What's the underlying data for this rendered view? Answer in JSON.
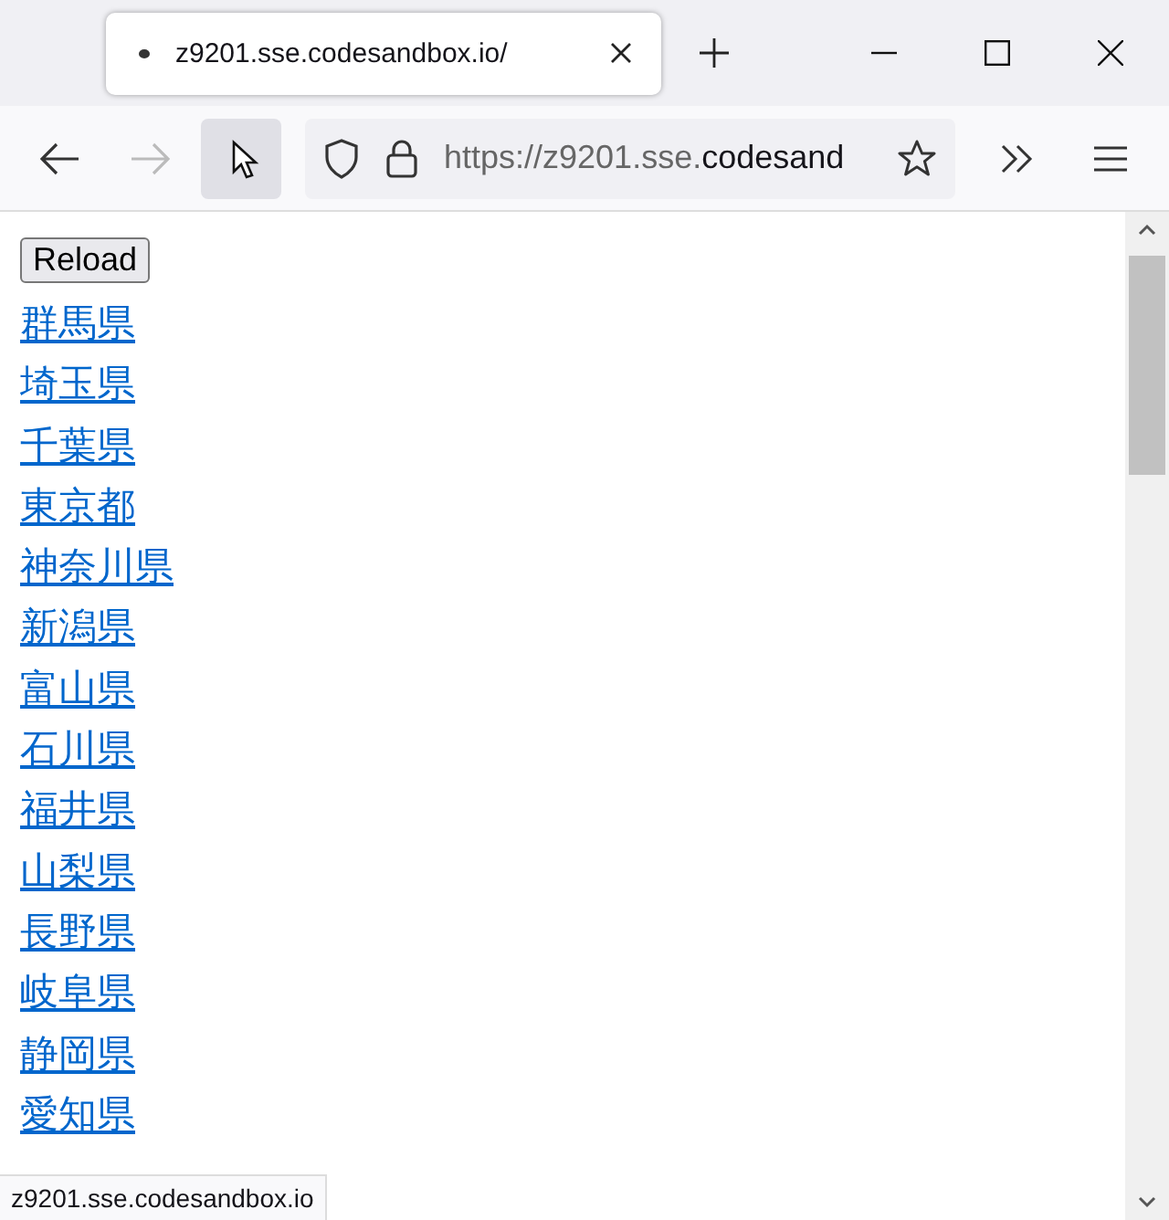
{
  "tab": {
    "title": "z9201.sse.codesandbox.io/",
    "selected": true
  },
  "address": {
    "prefix": "https://z9201.sse.",
    "domain": "codesand"
  },
  "toolbar": {
    "forward_disabled": true
  },
  "page": {
    "button": "Reload",
    "links": [
      "群馬県",
      "埼玉県",
      "千葉県",
      "東京都",
      "神奈川県",
      "新潟県",
      "富山県",
      "石川県",
      "福井県",
      "山梨県",
      "長野県",
      "岐阜県",
      "静岡県",
      "愛知県"
    ]
  },
  "status_bar": "z9201.sse.codesandbox.io"
}
